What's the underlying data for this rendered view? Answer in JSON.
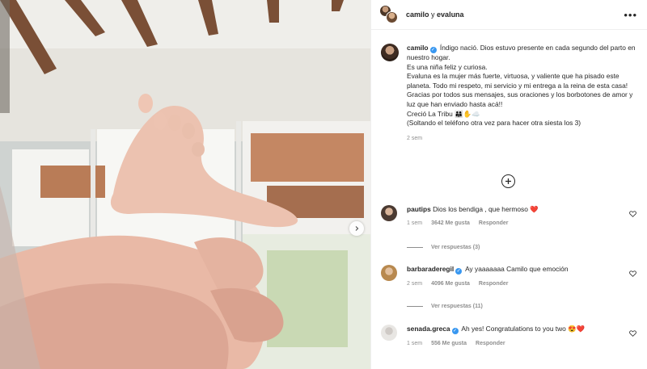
{
  "header": {
    "user1": "camilo",
    "conjunction": "y",
    "user2": "evaluna",
    "more_label": "•••"
  },
  "caption": {
    "user": "camilo",
    "lines": [
      "Índigo nació. Dios estuvo presente en cada segundo del parto en nuestro hogar.",
      "Es una niña feliz y curiosa.",
      "Evaluna es la mujer más fuerte, virtuosa, y valiente que ha pisado este planeta. Todo mi respeto, mi servicio y mi entrega a la reina de esta casa!",
      "Gracias por todos sus mensajes, sus oraciones y los borbotones de amor y luz que han enviado hasta acá!!",
      "Creció La Tribu 👨‍👩‍👧✋☁️",
      "(Soltando el teléfono otra vez para hacer otra siesta los 3)"
    ],
    "time": "2 sem"
  },
  "comments": [
    {
      "user": "pautips",
      "text": "Dios los bendiga , que hermoso ❤️",
      "time": "1 sem",
      "likes": "3642 Me gusta",
      "reply": "Responder",
      "view_replies": "Ver respuestas (3)"
    },
    {
      "user": "barbaraderegil",
      "text": "Ay yaaaaaaa Camilo que emoción",
      "time": "2 sem",
      "likes": "4096 Me gusta",
      "reply": "Responder",
      "view_replies": "Ver respuestas (11)"
    },
    {
      "user": "senada.greca",
      "text": "Ah yes! Congratulations to you two 😍❤️",
      "time": "1 sem",
      "likes": "556 Me gusta",
      "reply": "Responder"
    }
  ],
  "icons": {
    "verified": "verified-badge-icon",
    "load_more": "plus-circle-icon",
    "like": "heart-outline-icon",
    "next": "chevron-right-icon"
  },
  "colors": {
    "verified": "#3897f0",
    "secondary_text": "#8e8e8e",
    "primary_text": "#262626"
  }
}
